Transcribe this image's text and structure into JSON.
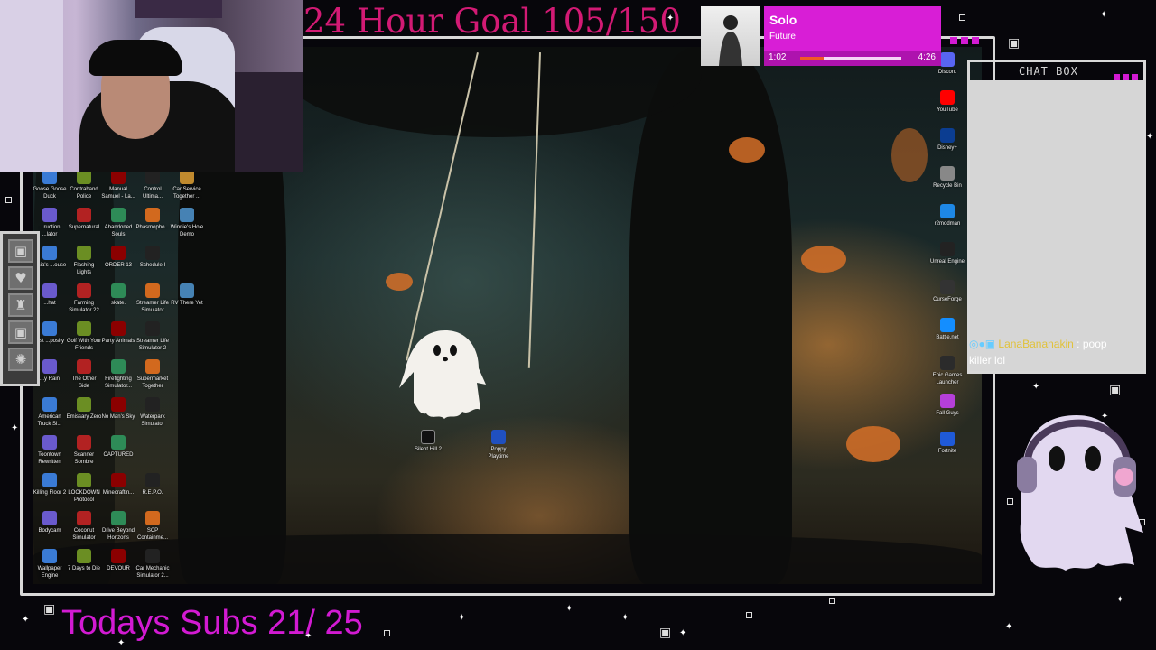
{
  "overlay": {
    "goal_text": "24 Hour Goal 105/150",
    "subs_text": "Todays Subs 21/ 25",
    "accent_color": "#d21a74",
    "subs_color": "#d21ad2"
  },
  "now_playing": {
    "title": "Solo",
    "artist": "Future",
    "elapsed": "1:02",
    "total": "4:26",
    "progress_fraction": 0.233,
    "panel_color": "#d81ed6"
  },
  "chat": {
    "header": "CHAT BOX",
    "message_user": "LanaBananakin",
    "message_sep": ":",
    "message_text": "poop",
    "message_line2": "killer lol"
  },
  "side_panel": {
    "icons": [
      "ghost-icon",
      "heart-icon",
      "trophy-icon",
      "ghost-icon",
      "sparkle-icon"
    ]
  },
  "desktop": {
    "left_icons": [
      [
        "Goose Goose Duck",
        "Contraband Police",
        "Manual Samuel - La...",
        "Control Ultima...",
        "Car Service Together ..."
      ],
      [
        "...ruction ...lator",
        "Supernatural",
        "Abandoned Souls",
        "Phasmopho...",
        "Winnie's Hole Demo"
      ],
      [
        "...sia's ...ouse",
        "Flashing Lights",
        "ORDER 13",
        "Schedule I",
        ""
      ],
      [
        "...hat",
        "Farming Simulator 22",
        "skate.",
        "Streamer Life Simulator",
        "RV There Yet"
      ],
      [
        "...st ...posity",
        "Golf With Your Friends",
        "Party Animals",
        "Streamer Life Simulator 2",
        ""
      ],
      [
        "...y Rain",
        "The Other Side",
        "Firefighting Simulator...",
        "Supermarket Together",
        ""
      ],
      [
        "American Truck Si...",
        "Emissary Zero",
        "No Man's Sky",
        "Waterpark Simulator",
        ""
      ],
      [
        "Toontown Rewritten",
        "Scanner Sombre",
        "CAPTURED",
        "",
        ""
      ],
      [
        "Killing Floor 2",
        "LOCKDOWN Protocol",
        "Minecraftin...",
        "R.E.P.O.",
        ""
      ],
      [
        "Bodycam",
        "Coconut Simulator",
        "Drive Beyond Horizons",
        "SCP Containme...",
        ""
      ],
      [
        "Wallpaper Engine",
        "7 Days to Die",
        "DEVOUR",
        "Car Mechanic Simulator 2...",
        ""
      ]
    ],
    "right_icons": [
      "Discord",
      "YouTube",
      "Disney+",
      "Recycle Bin",
      "r2modman",
      "Unreal Engine",
      "CurseForge",
      "Battle.net",
      "Epic Games Launcher",
      "Fall Guys",
      "Fortnite"
    ],
    "center_icons": [
      "Silent Hill 2",
      "Poppy Playtime"
    ],
    "icon_colors": [
      "#3a7bd5",
      "#6b8e23",
      "#8b0000",
      "#222222",
      "#c08a2e",
      "#6a5acd",
      "#b22222",
      "#2e8b57",
      "#d2691e",
      "#4682b4"
    ]
  }
}
